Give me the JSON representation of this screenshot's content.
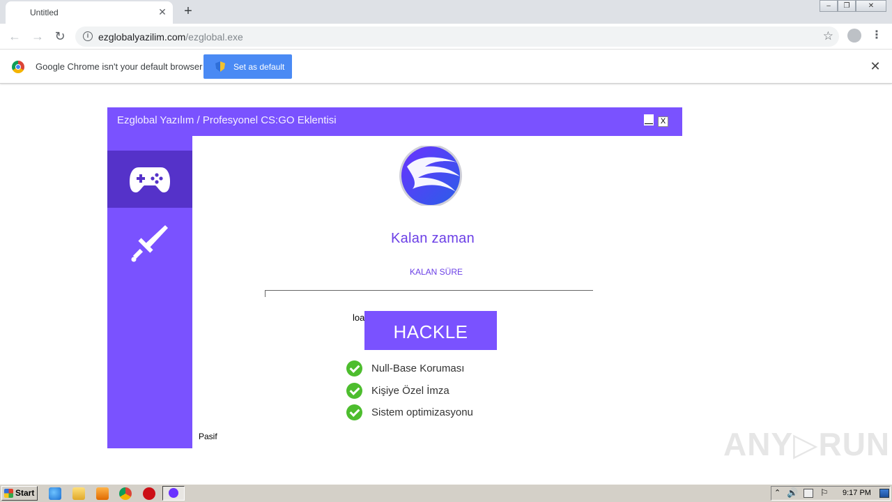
{
  "browser": {
    "tab_title": "Untitled",
    "tab_close": "✕",
    "new_tab": "+",
    "back_icon": "←",
    "forward_icon": "→",
    "reload_icon": "↻",
    "url_domain": "ezglobalyazilim.com",
    "url_path": "/ezglobal.exe",
    "star_icon": "☆",
    "menu_icon": "⋮",
    "window_minimize": "–",
    "window_restore": "❐",
    "window_close": "✕"
  },
  "infobar": {
    "message": "Google Chrome isn't your default browser",
    "button_label": "Set as default",
    "close_icon": "✕"
  },
  "app": {
    "title": "Ezglobal Yazılım / Profesyonel CS:GO Eklentisi",
    "close_label": "X",
    "heading": "Kalan zaman",
    "subheading": "KALAN SÜRE",
    "loading_text": "loa",
    "action_button": "HACKLE",
    "features": [
      {
        "label": "Null-Base Koruması"
      },
      {
        "label": "Kişiye Özel İmza"
      },
      {
        "label": "Sistem optimizasyonu"
      }
    ],
    "status": "Pasif",
    "progress": 0,
    "colors": {
      "accent": "#7a52ff",
      "sidebar_active": "#5532c9",
      "check": "#4dbd2e"
    },
    "sidebar_icons": [
      "gamepad-icon",
      "sword-icon"
    ]
  },
  "watermark": "ANY▷RUN",
  "taskbar": {
    "start_label": "Start",
    "clock": "9:17 PM"
  }
}
